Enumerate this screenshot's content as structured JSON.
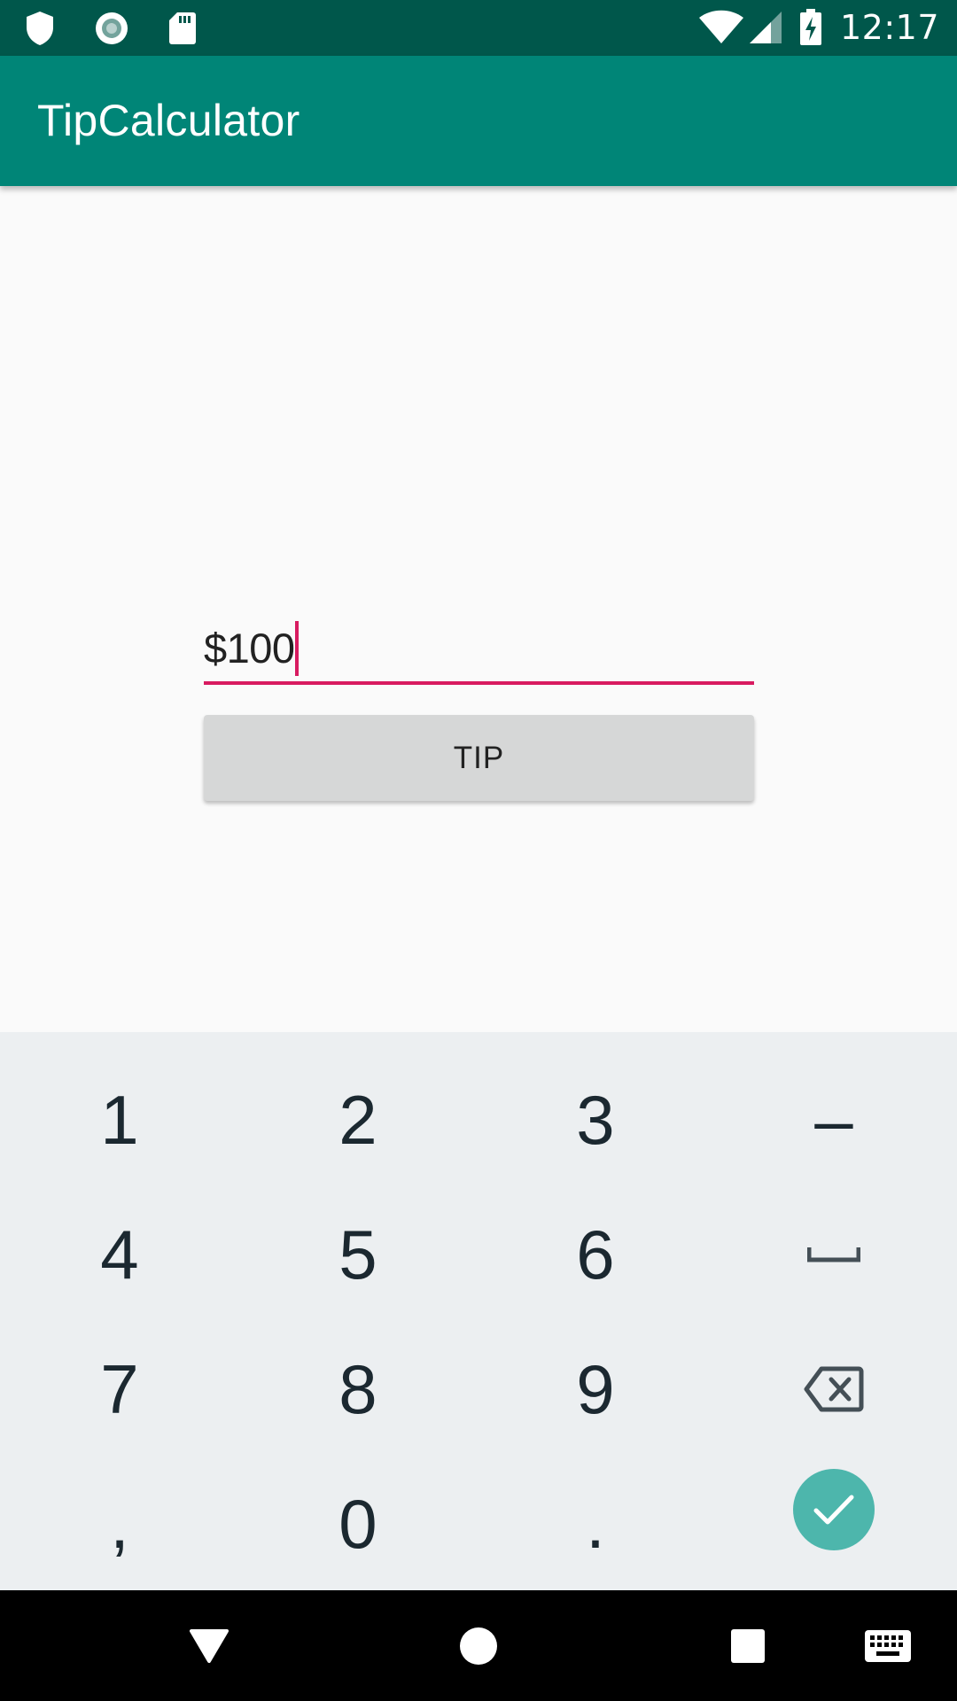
{
  "status_bar": {
    "time": "12:17",
    "left_icons": [
      "shield-icon",
      "record-icon",
      "sd-card-icon"
    ],
    "right_icons": [
      "wifi-icon",
      "cell-signal-icon",
      "battery-charging-icon"
    ]
  },
  "app_bar": {
    "title": "TipCalculator",
    "color": "#008577"
  },
  "form": {
    "amount_value": "$100",
    "tip_button_label": "TIP",
    "accent_color": "#d81b60"
  },
  "keyboard": {
    "rows": [
      [
        "1",
        "2",
        "3",
        "–"
      ],
      [
        "4",
        "5",
        "6",
        "space"
      ],
      [
        "7",
        "8",
        "9",
        "backspace"
      ],
      [
        ",",
        "0",
        ".",
        "enter"
      ]
    ],
    "keys": {
      "k1": "1",
      "k2": "2",
      "k3": "3",
      "minus": "–",
      "k4": "4",
      "k5": "5",
      "k6": "6",
      "k7": "7",
      "k8": "8",
      "k9": "9",
      "comma": ",",
      "k0": "0",
      "period": "."
    },
    "enter_color": "#4db6ac"
  },
  "nav_bar": {
    "buttons": [
      "back-icon",
      "home-icon",
      "recents-icon",
      "keyboard-switch-icon"
    ]
  }
}
